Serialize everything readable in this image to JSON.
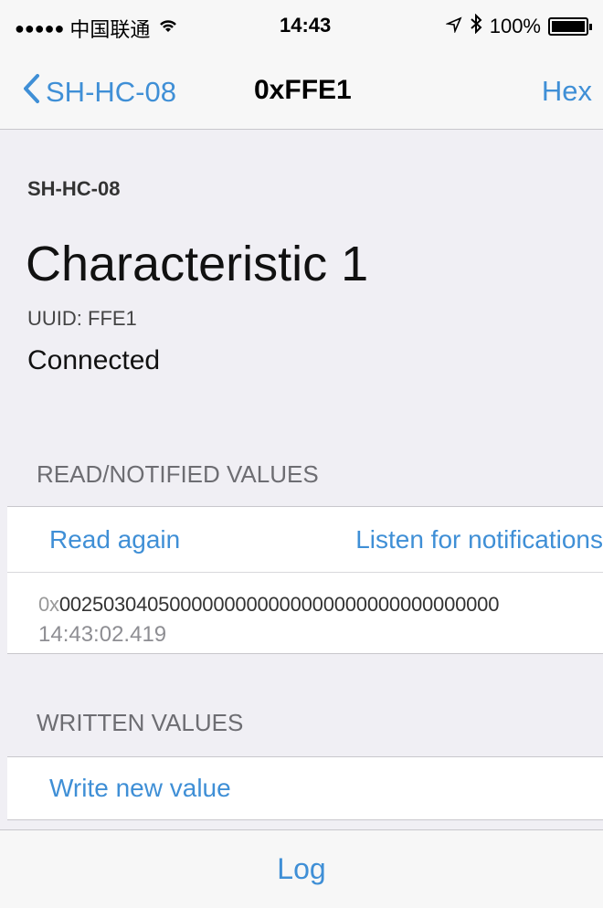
{
  "status_bar": {
    "signal": "●●●●●",
    "carrier": "中国联通",
    "wifi": "⫳",
    "time": "14:43",
    "location": "↗",
    "bluetooth": "✱",
    "battery": "100%"
  },
  "nav": {
    "back_label": "SH-HC-08",
    "title": "0xFFE1",
    "right_button": "Hex"
  },
  "header": {
    "device_name": "SH-HC-08",
    "characteristic_title": "Characteristic 1",
    "uuid": "UUID: FFE1",
    "status": "Connected"
  },
  "read_section": {
    "header": "READ/NOTIFIED VALUES",
    "read_again": "Read again",
    "listen": "Listen for notifications",
    "value_prefix": "0x",
    "value": "0025030405000000000000000000000000000000",
    "timestamp": "14:43:02.419"
  },
  "write_section": {
    "header": "WRITTEN VALUES",
    "write_new": "Write new value"
  },
  "footer": {
    "log": "Log"
  },
  "colors": {
    "accent": "#3f8fd6",
    "background": "#f0eff4"
  }
}
